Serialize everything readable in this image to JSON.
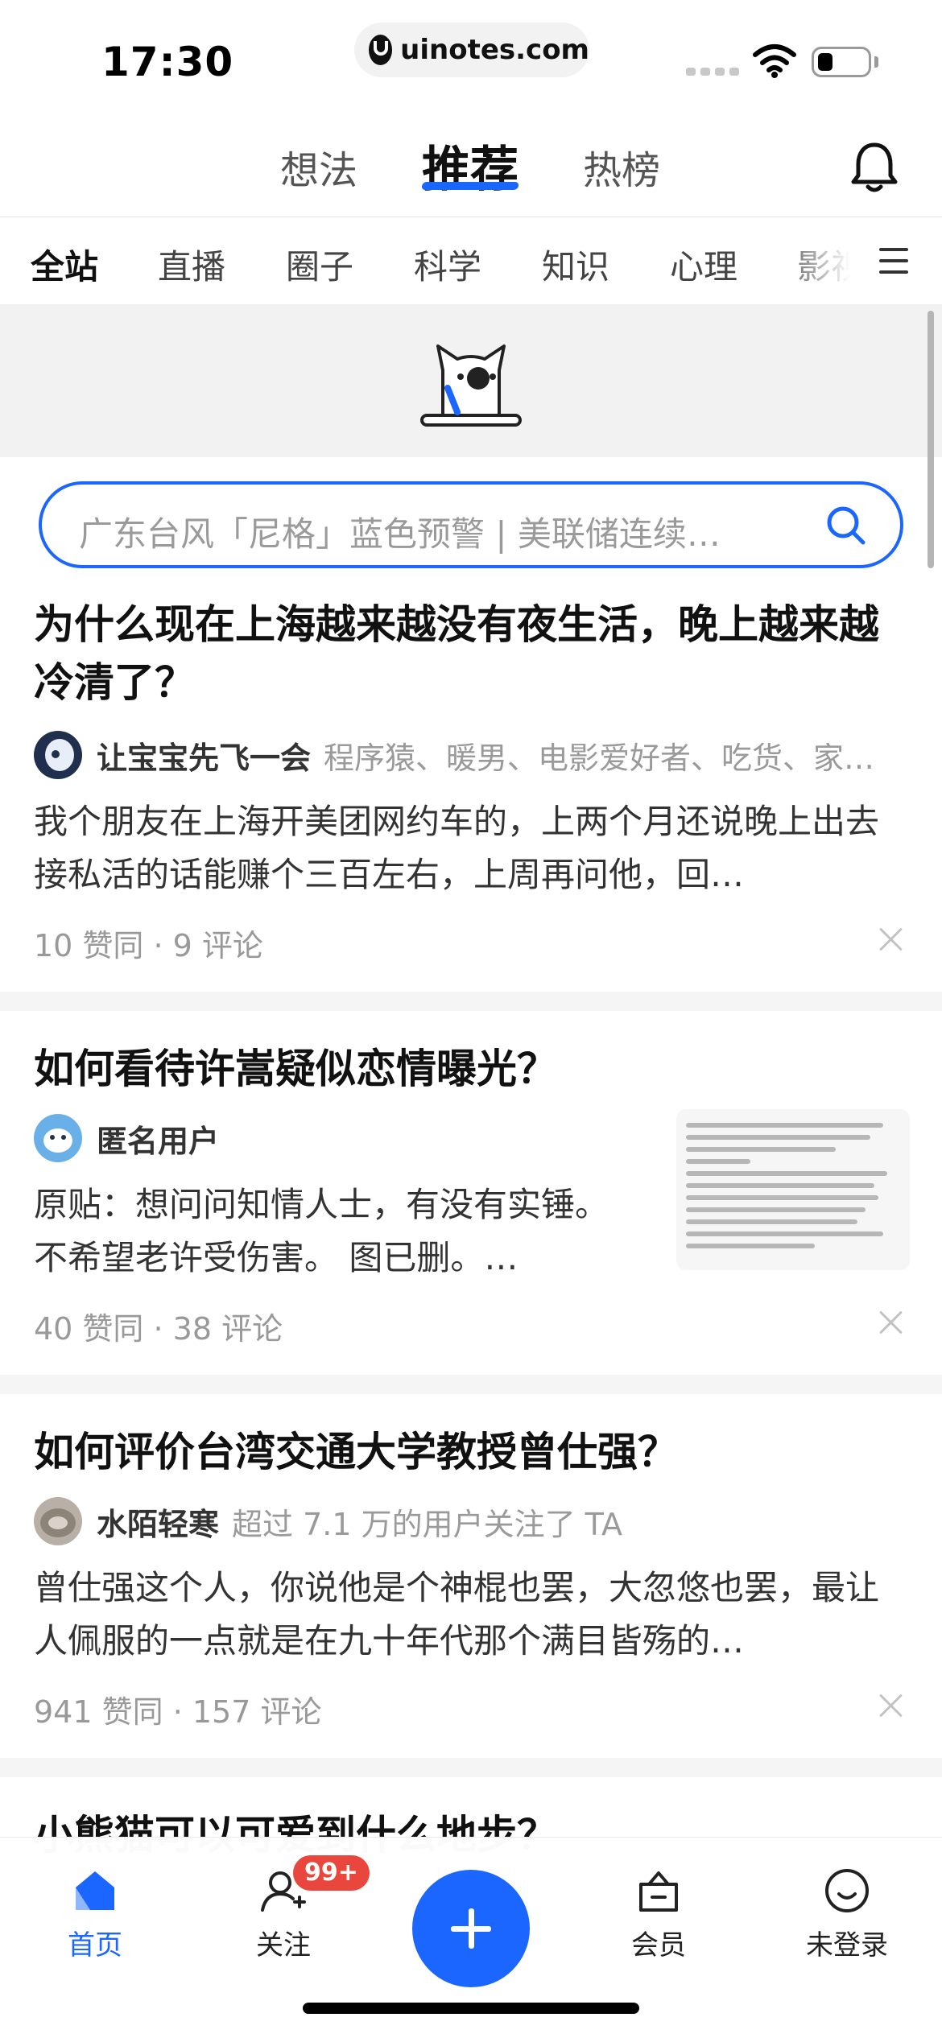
{
  "status_bar": {
    "time": "17:30",
    "url": "uinotes.com"
  },
  "top_tabs": [
    {
      "label": "想法",
      "active": false
    },
    {
      "label": "推荐",
      "active": true
    },
    {
      "label": "热榜",
      "active": false
    }
  ],
  "categories": [
    "全站",
    "直播",
    "圈子",
    "科学",
    "知识",
    "心理",
    "影视"
  ],
  "search": {
    "placeholder": "广东台风「尼格」蓝色预警 | 美联储连续…"
  },
  "feed": [
    {
      "title": "为什么现在上海越来越没有夜生活，晚上越来越冷清了？",
      "author": "让宝宝先飞一会",
      "bio": "程序猿、暖男、电影爱好者、吃货、家…",
      "excerpt": "我个朋友在上海开美团网约车的，上两个月还说晚上出去接私活的话能赚个三百左右，上周再问他，回…",
      "meta": "10 赞同 · 9 评论"
    },
    {
      "title": "如何看待许嵩疑似恋情曝光？",
      "author": "匿名用户",
      "bio": "",
      "excerpt": "原贴：想问问知情人士，有没有实锤。不希望老许受伤害。 图已删。…",
      "meta": "40 赞同 · 38 评论"
    },
    {
      "title": "如何评价台湾交通大学教授曾仕强？",
      "author": "水陌轻寒",
      "bio": "超过 7.1 万的用户关注了 TA",
      "excerpt": "曾仕强这个人，你说他是个神棍也罢，大忽悠也罢，最让人佩服的一点就是在九十年代那个满目皆殇的…",
      "meta": "941 赞同 · 157 评论"
    },
    {
      "title": "小熊猫可以可爱到什么地步？",
      "author": "",
      "bio": "",
      "excerpt": "",
      "meta": ""
    }
  ],
  "bottom_nav": [
    {
      "label": "首页",
      "icon": "home-icon",
      "active": true
    },
    {
      "label": "关注",
      "icon": "follow-icon",
      "badge": "99+"
    },
    {
      "label": "",
      "icon": "plus-icon"
    },
    {
      "label": "会员",
      "icon": "vip-icon"
    },
    {
      "label": "未登录",
      "icon": "profile-icon"
    }
  ],
  "colors": {
    "accent": "#1a66ff",
    "badge": "#e9473d"
  }
}
